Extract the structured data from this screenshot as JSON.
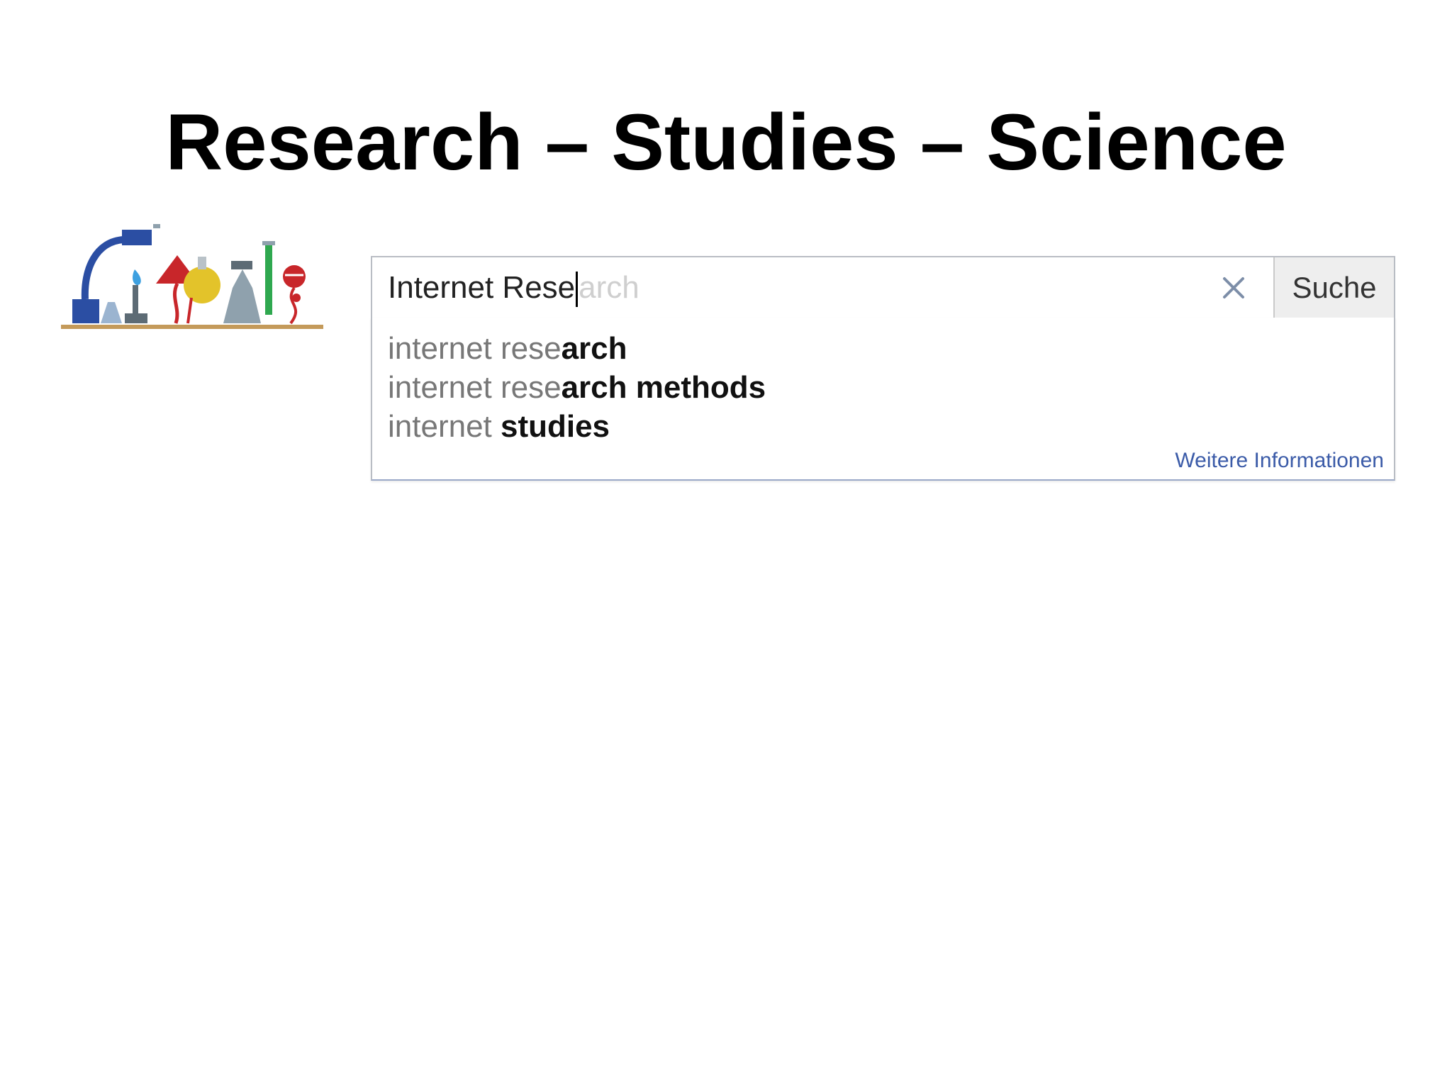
{
  "slide": {
    "title": "Research – Studies – Science"
  },
  "doodle": {
    "icon": "science-lab-doodle-icon",
    "colors": [
      "#2b4ea3",
      "#c8262a",
      "#e3c32a",
      "#2fa84f",
      "#8fa1ad",
      "#c49a5a"
    ]
  },
  "search": {
    "typed_text": "Internet Rese",
    "completion_text": "arch",
    "clear_icon": "close-icon",
    "button_label": "Suche",
    "suggestions": [
      {
        "prefix": "internet rese",
        "suffix": "arch"
      },
      {
        "prefix": "internet rese",
        "suffix": "arch methods"
      },
      {
        "prefix": "internet ",
        "suffix": "studies"
      }
    ],
    "more_info_label": "Weitere Informationen"
  }
}
